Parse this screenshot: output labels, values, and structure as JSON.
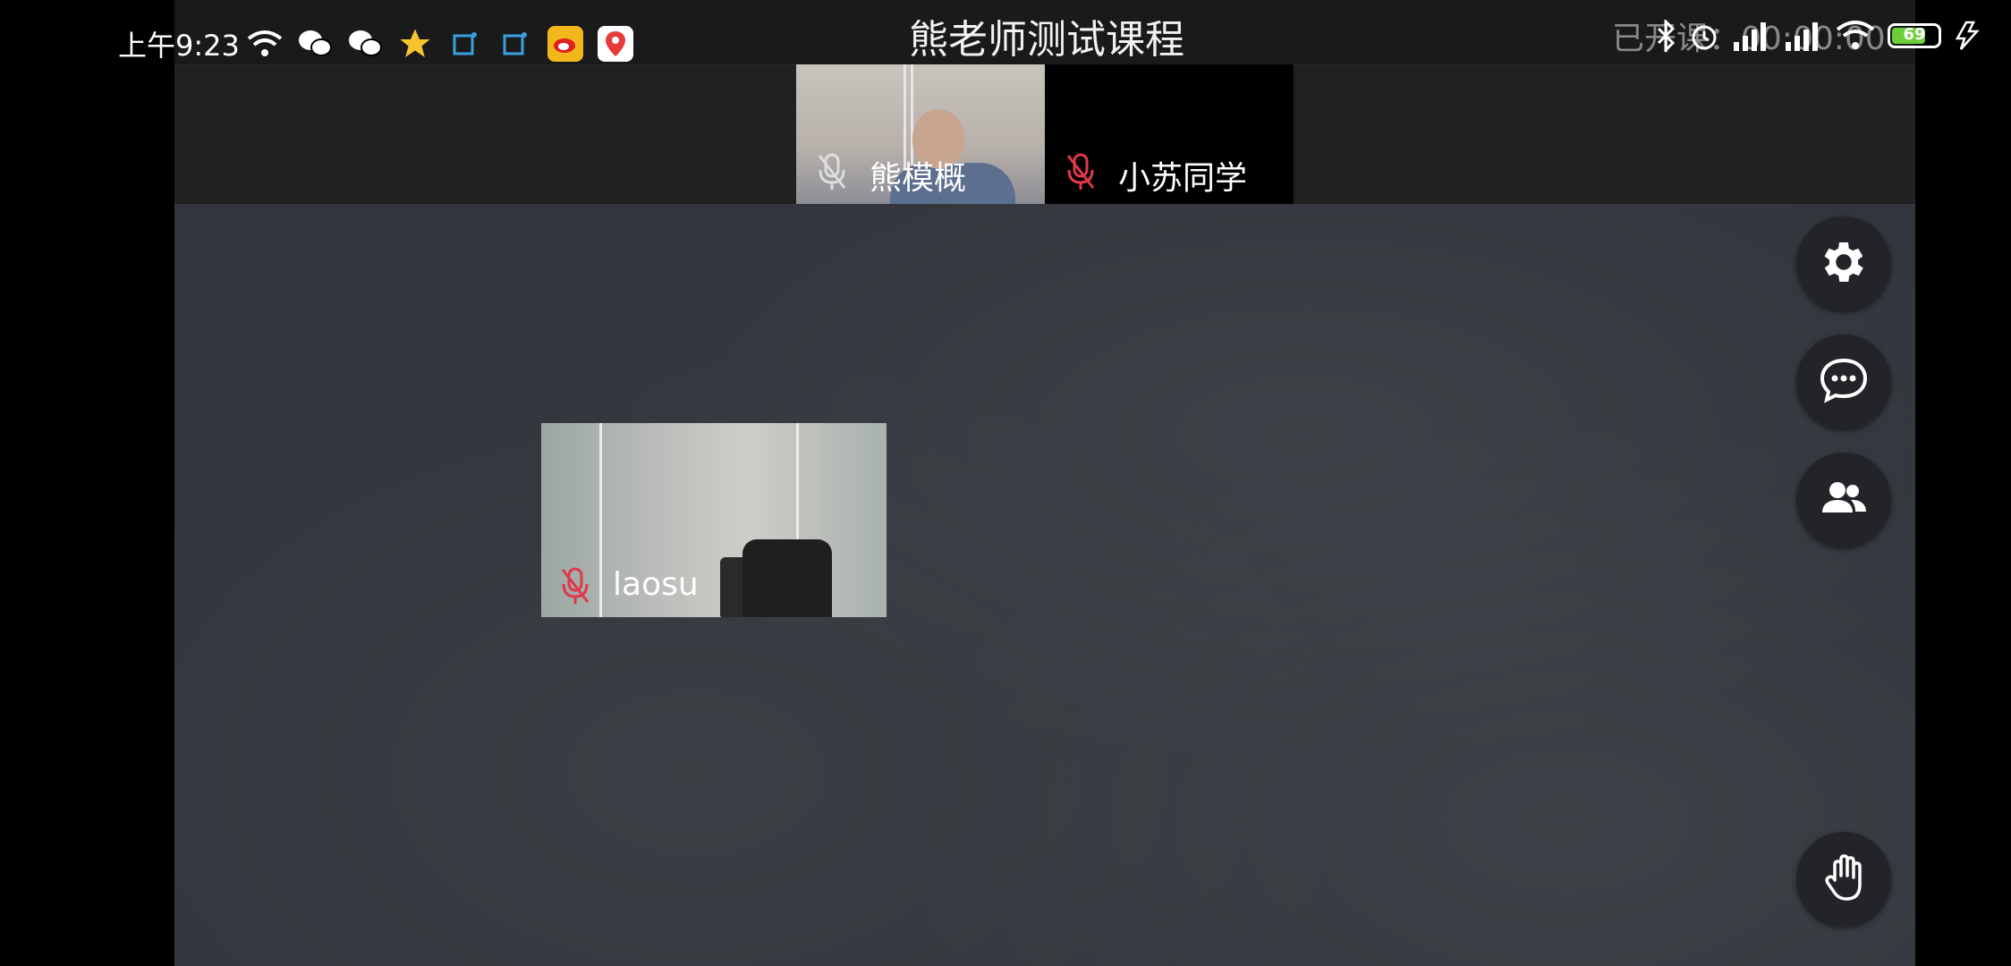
{
  "status_bar": {
    "time": "上午9:23",
    "battery_level": "69",
    "accent_colors": {
      "battery": "#6ccf3a",
      "star": "#f7c42c",
      "weibo": "#f2b71a",
      "du": "#e63b3b"
    }
  },
  "header": {
    "title": "熊老师测试课程",
    "class_time_label": "已开课：00:00:00"
  },
  "videos": [
    {
      "name": "熊模概",
      "mic": "muted"
    },
    {
      "name": "小苏同学",
      "mic": "muted"
    },
    {
      "name": "laosu",
      "mic": "muted"
    }
  ],
  "side_buttons": [
    {
      "icon": "gear-icon",
      "label": "settings"
    },
    {
      "icon": "chat-icon",
      "label": "chat"
    },
    {
      "icon": "people-icon",
      "label": "participants"
    },
    {
      "icon": "raise-hand-icon",
      "label": "raise hand"
    }
  ],
  "colors": {
    "board": "#33373d",
    "topbar": "#212121",
    "mic_muted": "#e0384b"
  }
}
